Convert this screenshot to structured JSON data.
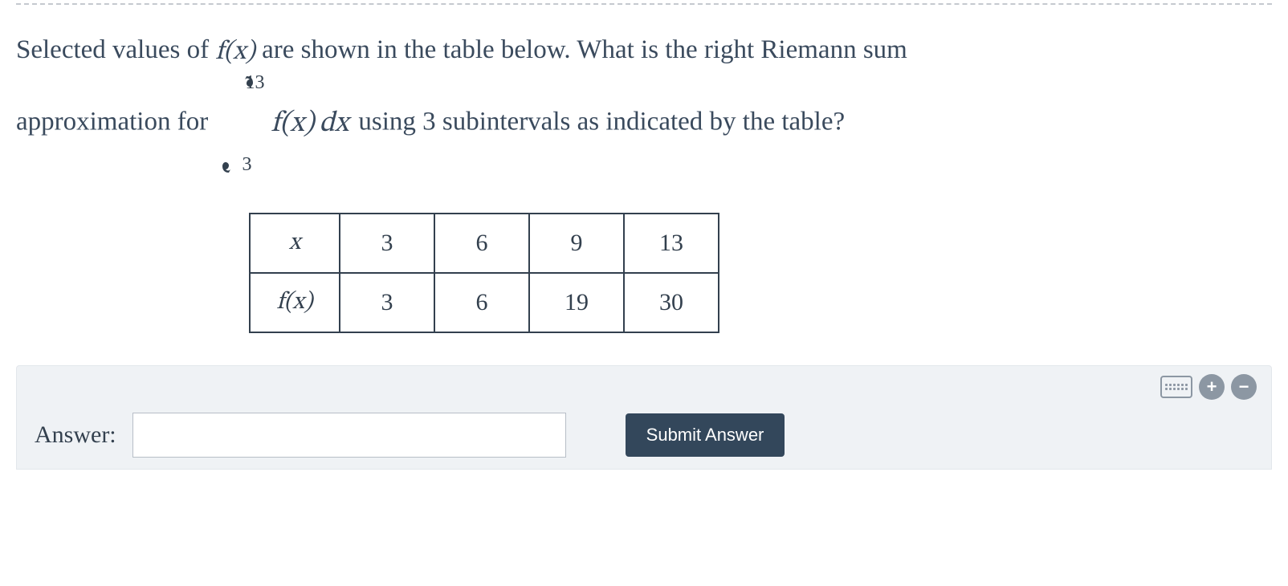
{
  "question": {
    "line1_pre": "Selected values of ",
    "fx": "f(x)",
    "line1_post": " are shown in the table below. What is the right Riemann sum",
    "line2_pre": "approximation for ",
    "integral": {
      "lower": "3",
      "upper": "13",
      "integrand_f": "f(x)",
      "integrand_dx": "dx"
    },
    "line2_post": " using 3 subintervals as indicated by the table?"
  },
  "table": {
    "row_x_label": "x",
    "row_fx_label": "f(x)",
    "x_values": [
      "3",
      "6",
      "9",
      "13"
    ],
    "fx_values": [
      "3",
      "6",
      "19",
      "30"
    ]
  },
  "answer_bar": {
    "label": "Answer:",
    "input_value": "",
    "submit_label": "Submit Answer"
  }
}
